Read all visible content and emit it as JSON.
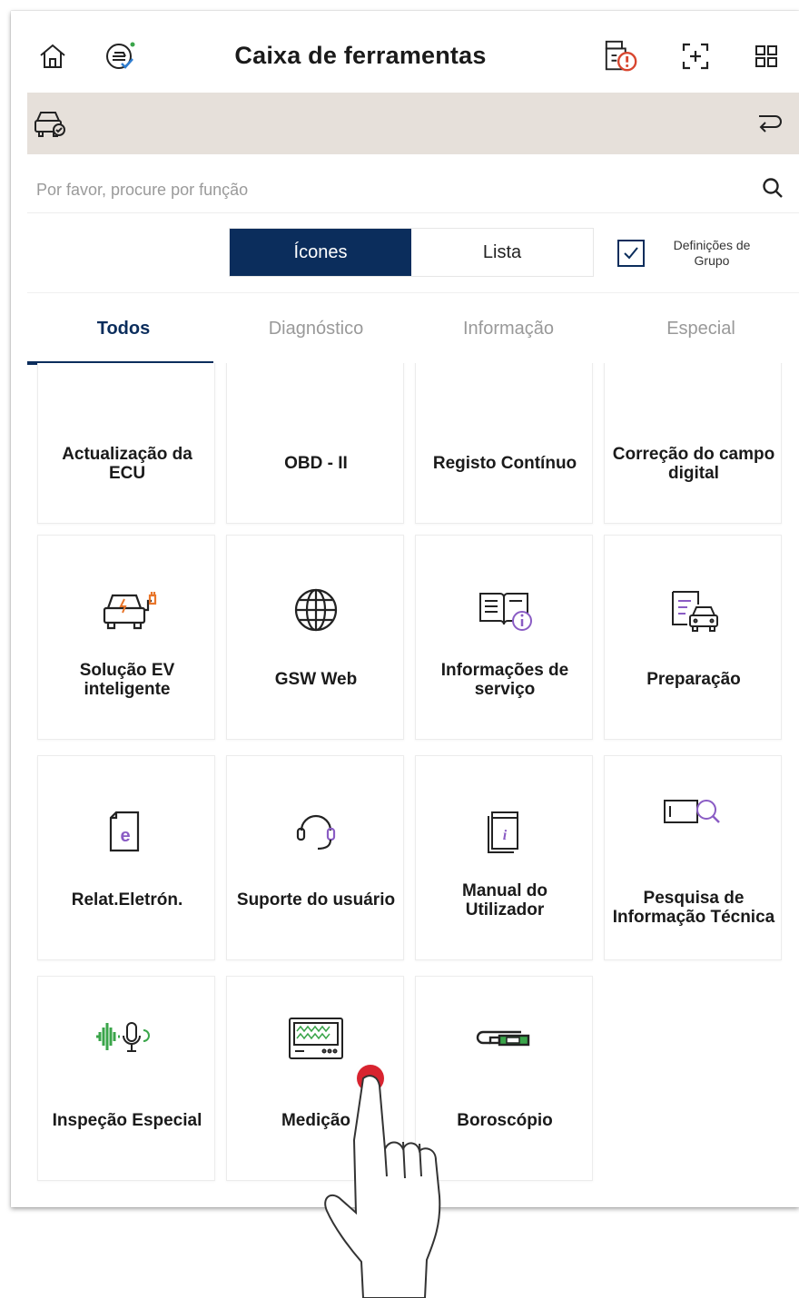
{
  "header": {
    "title": "Caixa de ferramentas"
  },
  "search": {
    "placeholder": "Por favor, procure por função"
  },
  "view_toggle": {
    "icons_label": "Ícones",
    "list_label": "Lista",
    "selected": "Ícones"
  },
  "group_settings": {
    "label": "Definições de Grupo",
    "checked": true
  },
  "tabs": [
    {
      "label": "Todos",
      "active": true
    },
    {
      "label": "Diagnóstico",
      "active": false
    },
    {
      "label": "Informação",
      "active": false
    },
    {
      "label": "Especial",
      "active": false
    }
  ],
  "tools": [
    {
      "label": "Actualização da ECU",
      "icon": "ecu-update-icon"
    },
    {
      "label": "OBD - II",
      "icon": "obd-icon"
    },
    {
      "label": "Registo Contínuo",
      "icon": "continuous-log-icon"
    },
    {
      "label": "Correção do campo digital",
      "icon": "digital-field-icon"
    },
    {
      "label": "Solução EV inteligente",
      "icon": "ev-car-charging-icon"
    },
    {
      "label": "GSW Web",
      "icon": "globe-icon"
    },
    {
      "label": "Informações de serviço",
      "icon": "book-info-icon"
    },
    {
      "label": "Preparação",
      "icon": "document-car-icon"
    },
    {
      "label": "Relat.Eletrón.",
      "icon": "e-document-icon"
    },
    {
      "label": "Suporte do usuário",
      "icon": "headset-icon"
    },
    {
      "label": "Manual do Utilizador",
      "icon": "manual-book-icon"
    },
    {
      "label": "Pesquisa de Informação Técnica",
      "icon": "search-document-icon"
    },
    {
      "label": "Inspeção Especial",
      "icon": "sound-microphone-icon"
    },
    {
      "label": "Medição",
      "icon": "oscilloscope-icon"
    },
    {
      "label": "Boroscópio",
      "icon": "borescope-icon"
    }
  ],
  "colors": {
    "primary": "#0b2d5c",
    "vehicle_bar": "#e6e0da",
    "accent_orange": "#e8752a",
    "accent_purple": "#8a5cc4",
    "accent_green": "#3aa54a",
    "touch": "#d8232f"
  }
}
